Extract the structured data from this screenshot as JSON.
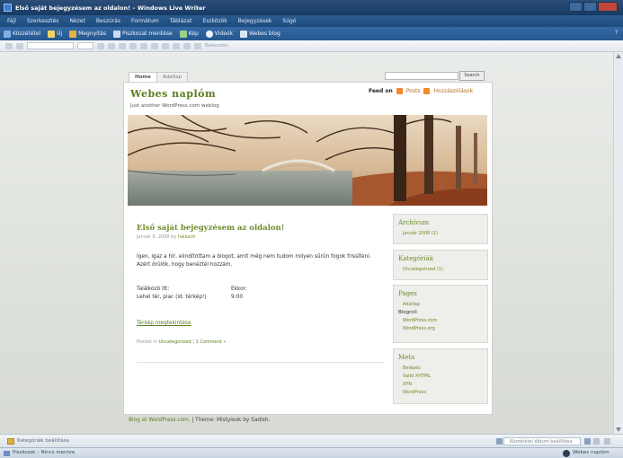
{
  "window": {
    "title": "Első saját bejegyzésem az oldalon! – Windows Live Writer"
  },
  "menu": [
    "Fájl",
    "Szerkesztés",
    "Nézet",
    "Beszúrás",
    "Formátum",
    "Táblázat",
    "Eszközök",
    "Bejegyzések",
    "Súgó"
  ],
  "toolbar": {
    "items": [
      "Közzététel",
      "Új",
      "Megnyitás",
      "Piszkozat mentése",
      "Kép",
      "Videók",
      "Webes blog"
    ],
    "right": "?"
  },
  "toolbar2": {
    "style_label": "Bekezdés"
  },
  "editor": {
    "tabs": [
      "Home",
      "Adatlap"
    ],
    "search_button": "Search",
    "blog_title": "Webes naplóm",
    "tagline": "Just another WordPress.com weblog",
    "feed_on": "Feed on",
    "feed_posts": "Posts",
    "feed_comments": "Hozzászólások",
    "post": {
      "title": "Első saját bejegyzésem az oldalon!",
      "date": "január 6, 2008 by",
      "author": "halasim",
      "text": "Igen, igaz a hír, elindítottam a blogot, amit még nem tudom milyen sűrűn fogok frissíteni. Azért örülök, hogy benéztél hozzám.",
      "meet_label_1": "Találkozó itt:",
      "meet_value_1": "Lehel tér, piac (ld. térkép!)",
      "meet_label_2": "Ekkor:",
      "meet_value_2": "9:00",
      "map_link": "Térkép megtekintése",
      "posted_in": "Posted in",
      "category": "Uncategorized",
      "separator": "|",
      "comments": "1 Comment »"
    },
    "sidebar": {
      "archive_title": "Archívum",
      "archive_items": [
        "január 2008 (1)"
      ],
      "categories_title": "Kategóriák",
      "categories_items": [
        "Uncategorized (1)"
      ],
      "pages_title": "Pages",
      "pages_items": [
        "Adatlap"
      ],
      "blogroll_label": "Blogroll",
      "blogroll_items": [
        "WordPress.com",
        "WordPress.org"
      ],
      "meta_title": "Meta",
      "meta_items": [
        "Belépés",
        "Valid XHTML",
        "XFN",
        "WordPress"
      ]
    },
    "footer_blog": "Blog at WordPress.com.",
    "footer_theme": " | Theme: Mistylook by Sadish."
  },
  "bottombar": {
    "categories_label": "Kategóriák beállítása",
    "date_label": "Közzététel dátum beállítása"
  },
  "statusbar": {
    "status": "Piszkozat – Nincs mentve",
    "blog_name": "Webes naplóm"
  },
  "colors": {
    "accent_green": "#6d8b2c",
    "feed_orange": "#f08a2a",
    "chrome_blue": "#255890"
  }
}
